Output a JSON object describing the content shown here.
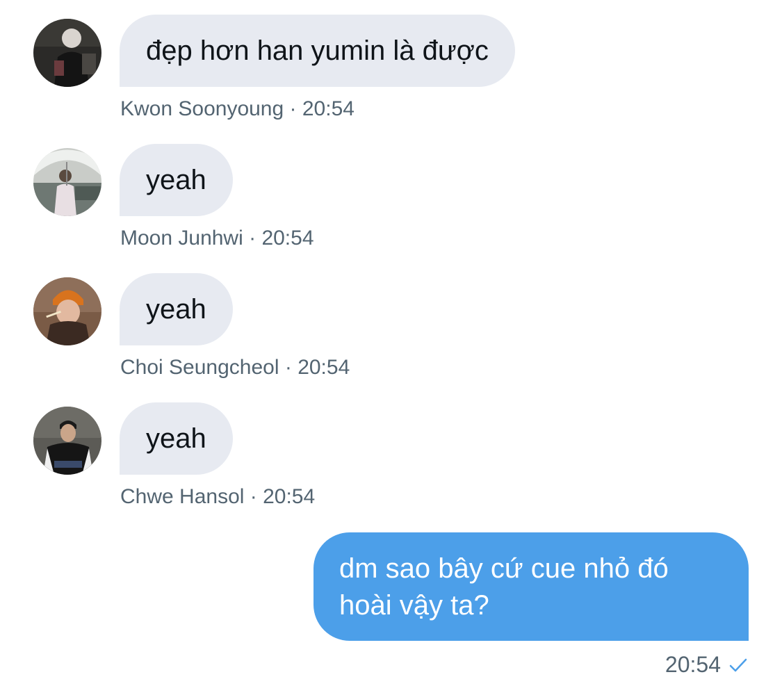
{
  "messages": [
    {
      "author": "Kwon Soonyoung",
      "time": "20:54",
      "text": "đẹp hơn han yumin là được",
      "avatar": "avatar-kwon-soonyoung",
      "separator": " · "
    },
    {
      "author": "Moon Junhwi",
      "time": "20:54",
      "text": "yeah",
      "avatar": "avatar-moon-junhwi",
      "separator": " · "
    },
    {
      "author": "Choi Seungcheol",
      "time": "20:54",
      "text": "yeah",
      "avatar": "avatar-choi-seungcheol",
      "separator": " · "
    },
    {
      "author": "Chwe Hansol",
      "time": "20:54",
      "text": "yeah",
      "avatar": "avatar-chwe-hansol",
      "separator": " · "
    }
  ],
  "outgoing": {
    "line1": "dm sao bây cứ cue nhỏ đó",
    "line2": "hoài vậy ta?",
    "time": "20:54",
    "status_icon": "check-icon"
  },
  "colors": {
    "incoming_bubble": "#e7eaf1",
    "outgoing_bubble": "#4c9fe9",
    "meta_text": "#536471",
    "check": "#4c9fe9"
  }
}
